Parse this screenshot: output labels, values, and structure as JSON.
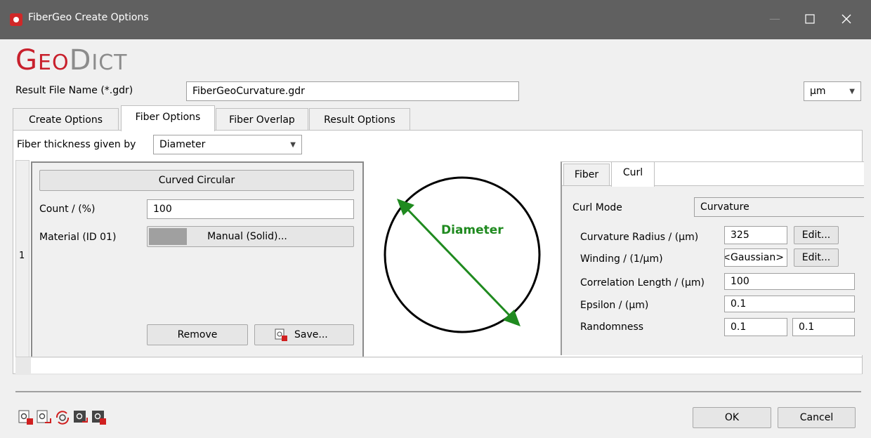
{
  "window": {
    "title": "FiberGeo Create Options"
  },
  "logo": {
    "text_part1": "G",
    "text_part2": "EO",
    "text_part3": "D",
    "text_part4": "ICT"
  },
  "result_file": {
    "label": "Result File Name (*.gdr)",
    "value": "FiberGeoCurvature.gdr"
  },
  "unit_select": {
    "value": "µm"
  },
  "tabs": [
    {
      "label": "Create Options"
    },
    {
      "label": "Fiber Options"
    },
    {
      "label": "Fiber Overlap"
    },
    {
      "label": "Result Options"
    }
  ],
  "fiber_options": {
    "thickness_label": "Fiber thickness given by",
    "thickness_value": "Diameter",
    "row_number": "1",
    "fiber_type_button": "Curved Circular",
    "count_label": "Count / (%)",
    "count_value": "100",
    "material_label": "Material (ID 01)",
    "material_button": "Manual (Solid)...",
    "material_color": "#a0a0a0",
    "remove_button": "Remove",
    "save_button": "Save..."
  },
  "diagram": {
    "label": "Diameter",
    "color": "#1f8a1f"
  },
  "subtabs": [
    {
      "label": "Fiber"
    },
    {
      "label": "Curl"
    }
  ],
  "curl": {
    "mode_label": "Curl Mode",
    "mode_value": "Curvature",
    "radius_label": "Curvature Radius / (µm)",
    "radius_value": "325",
    "radius_edit": "Edit...",
    "winding_label": "Winding / (1/µm)",
    "winding_value": "<Gaussian>",
    "winding_edit": "Edit...",
    "correlation_label": "Correlation Length / (µm)",
    "correlation_value": "100",
    "epsilon_label": "Epsilon / (µm)",
    "epsilon_value": "0.1",
    "randomness_label": "Randomness",
    "randomness_value1": "0.1",
    "randomness_value2": "0.1"
  },
  "footer": {
    "ok": "OK",
    "cancel": "Cancel"
  },
  "accent_color": "#c8202c"
}
